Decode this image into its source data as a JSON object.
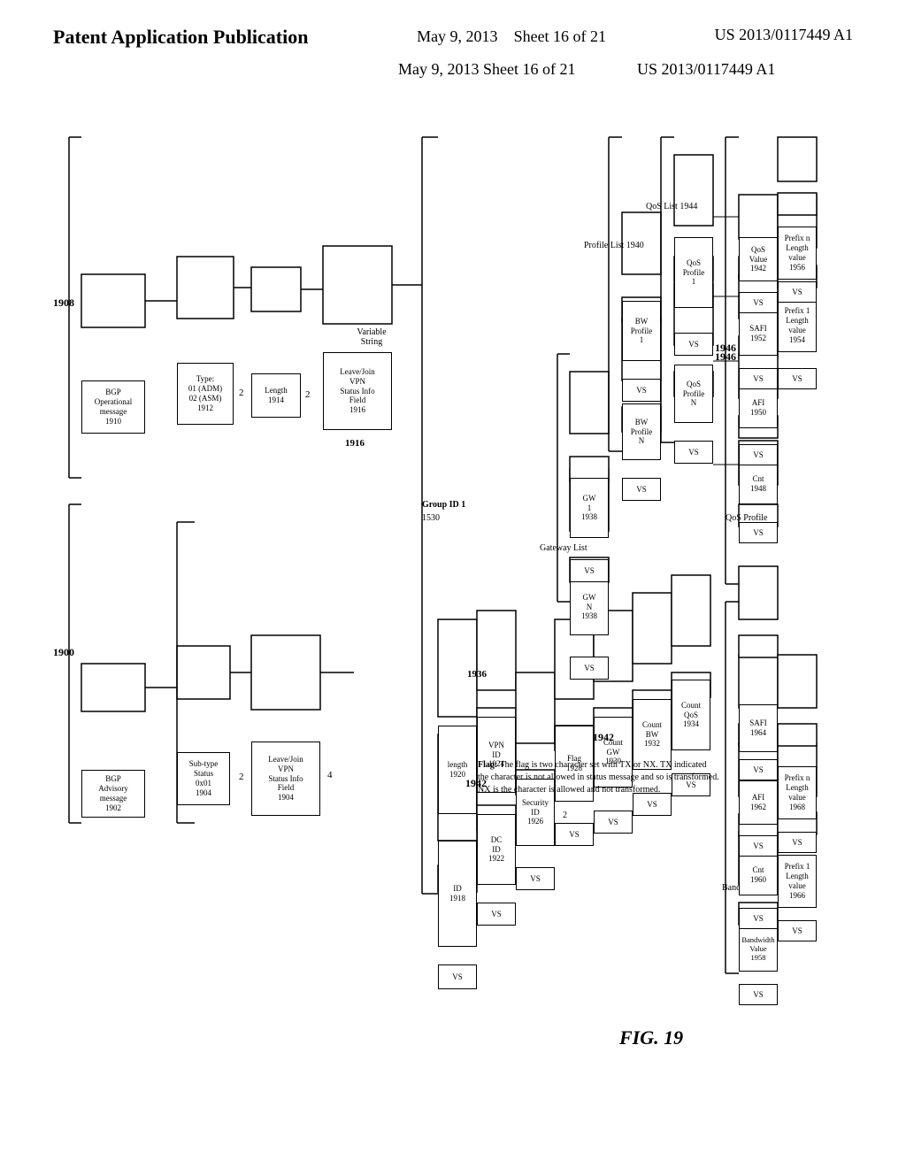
{
  "header": {
    "left": "Patent Application Publication",
    "center_date": "May 9, 2013",
    "center_sheet": "Sheet 16 of 21",
    "right": "US 2013/0117449 A1"
  },
  "figure": {
    "label": "FIG. 19",
    "number": "1900_label"
  },
  "notes": {
    "flag_note": "Flag: The flag is two character set with TX or NX. TX indicated\nthe character is not allowed in status message and so is transformed.\nNX is the character is allowed and not transformed.",
    "label_1942": "1942",
    "label_1946": "1946"
  }
}
